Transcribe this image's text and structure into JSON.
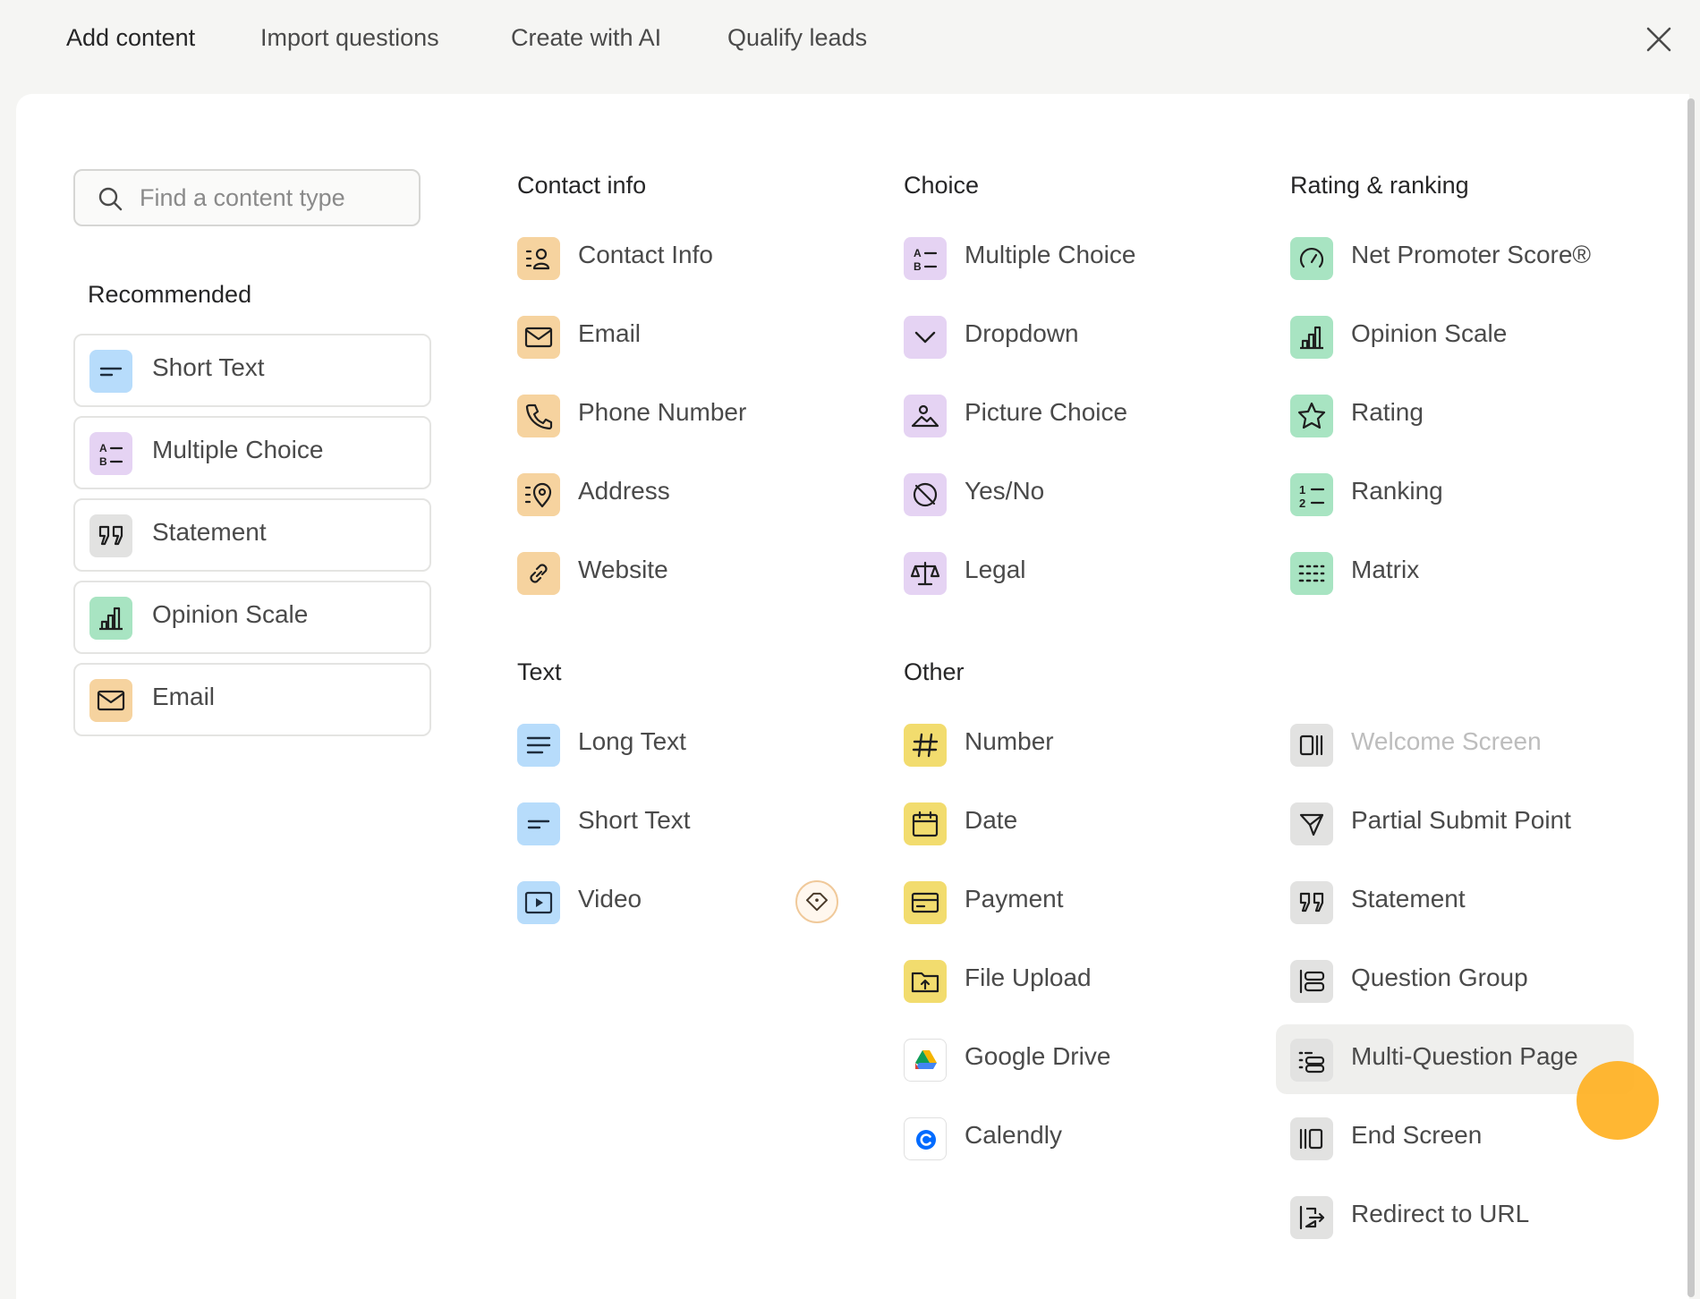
{
  "tabs": [
    {
      "label": "Add content"
    },
    {
      "label": "Import questions"
    },
    {
      "label": "Create with AI"
    },
    {
      "label": "Qualify leads"
    }
  ],
  "search": {
    "placeholder": "Find a content type",
    "value": ""
  },
  "recommended": {
    "title": "Recommended",
    "items": [
      {
        "label": "Short Text",
        "icon": "short-text-icon"
      },
      {
        "label": "Multiple Choice",
        "icon": "multiple-choice-icon"
      },
      {
        "label": "Statement",
        "icon": "quote-icon"
      },
      {
        "label": "Opinion Scale",
        "icon": "bar-chart-icon"
      },
      {
        "label": "Email",
        "icon": "envelope-icon"
      }
    ]
  },
  "contact": {
    "title": "Contact info",
    "items": [
      {
        "label": "Contact Info",
        "icon": "contact-card-icon"
      },
      {
        "label": "Email",
        "icon": "envelope-icon"
      },
      {
        "label": "Phone Number",
        "icon": "phone-icon"
      },
      {
        "label": "Address",
        "icon": "location-pin-icon"
      },
      {
        "label": "Website",
        "icon": "link-icon"
      }
    ]
  },
  "choice": {
    "title": "Choice",
    "items": [
      {
        "label": "Multiple Choice",
        "icon": "multiple-choice-icon"
      },
      {
        "label": "Dropdown",
        "icon": "chevron-down-icon"
      },
      {
        "label": "Picture Choice",
        "icon": "landscape-image-icon"
      },
      {
        "label": "Yes/No",
        "icon": "yes-no-icon"
      },
      {
        "label": "Legal",
        "icon": "scales-icon"
      }
    ]
  },
  "rating": {
    "title": "Rating & ranking",
    "items": [
      {
        "label": "Net Promoter Score®",
        "icon": "gauge-icon"
      },
      {
        "label": "Opinion Scale",
        "icon": "bar-chart-icon"
      },
      {
        "label": "Rating",
        "icon": "star-icon"
      },
      {
        "label": "Ranking",
        "icon": "numbered-list-icon"
      },
      {
        "label": "Matrix",
        "icon": "grid-icon"
      }
    ]
  },
  "text": {
    "title": "Text",
    "items": [
      {
        "label": "Long Text",
        "icon": "long-text-icon"
      },
      {
        "label": "Short Text",
        "icon": "short-text-icon"
      },
      {
        "label": "Video",
        "icon": "video-play-icon",
        "badge": "pro-diamond-icon"
      }
    ]
  },
  "other": {
    "title": "Other",
    "items": [
      {
        "label": "Number",
        "icon": "hash-icon"
      },
      {
        "label": "Date",
        "icon": "calendar-icon"
      },
      {
        "label": "Payment",
        "icon": "credit-card-icon"
      },
      {
        "label": "File Upload",
        "icon": "folder-upload-icon"
      },
      {
        "label": "Google Drive",
        "icon": "google-drive-icon"
      },
      {
        "label": "Calendly",
        "icon": "calendly-icon"
      }
    ]
  },
  "screens": {
    "items": [
      {
        "label": "Welcome Screen",
        "icon": "welcome-screen-icon",
        "disabled": true
      },
      {
        "label": "Partial Submit Point",
        "icon": "paper-plane-icon"
      },
      {
        "label": "Statement",
        "icon": "quote-icon"
      },
      {
        "label": "Question Group",
        "icon": "question-group-icon"
      },
      {
        "label": "Multi-Question Page",
        "icon": "multi-question-icon",
        "hovered": true
      },
      {
        "label": "End Screen",
        "icon": "end-screen-icon"
      },
      {
        "label": "Redirect to URL",
        "icon": "redirect-icon"
      }
    ]
  },
  "colors": {
    "text_blue": "#b7dcfb",
    "choice_purple": "#e5d3f3",
    "contact_orange": "#f6d39f",
    "rating_green": "#a8e4c2",
    "other_yellow": "#f2dc6e",
    "layout_gray": "#e2e2e1",
    "cursor_orange": "#ffb122"
  }
}
